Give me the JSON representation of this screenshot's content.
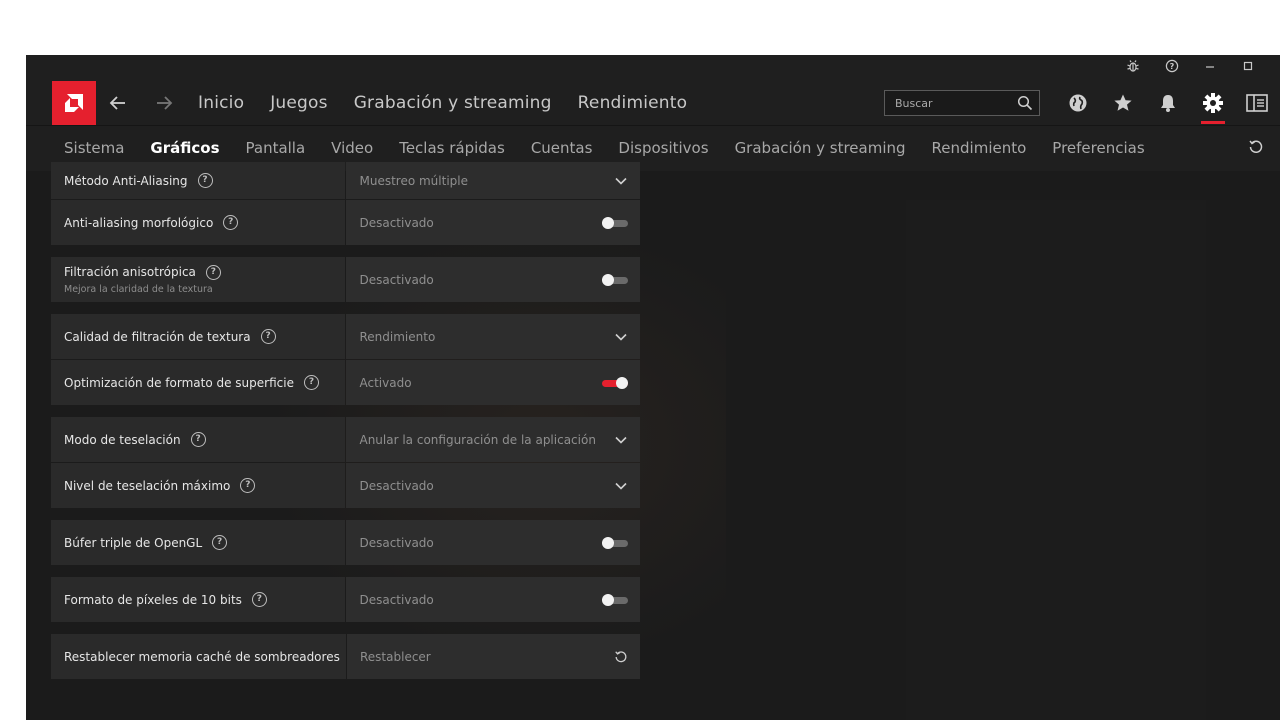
{
  "window": {
    "controls": [
      "bug-icon",
      "help-icon",
      "minimize",
      "maximize"
    ]
  },
  "topnav": {
    "links": [
      "Inicio",
      "Juegos",
      "Grabación y streaming",
      "Rendimiento"
    ],
    "search_placeholder": "Buscar",
    "icons": [
      "globe-icon",
      "star-icon",
      "bell-icon",
      "gear-icon",
      "sidebar-icon"
    ],
    "active_icon": "gear-icon"
  },
  "subnav": {
    "tabs": [
      "Sistema",
      "Gráficos",
      "Pantalla",
      "Video",
      "Teclas rápidas",
      "Cuentas",
      "Dispositivos",
      "Grabación y streaming",
      "Rendimiento",
      "Preferencias"
    ],
    "active": "Gráficos"
  },
  "settings": {
    "aa_method": {
      "label": "Método Anti-Aliasing",
      "value": "Muestreo múltiple",
      "control": "dropdown"
    },
    "morph_aa": {
      "label": "Anti-aliasing morfológico",
      "value": "Desactivado",
      "control": "toggle",
      "on": false
    },
    "aniso": {
      "label": "Filtración anisotrópica",
      "sub": "Mejora la claridad de la textura",
      "value": "Desactivado",
      "control": "toggle",
      "on": false
    },
    "tex_quality": {
      "label": "Calidad de filtración de textura",
      "value": "Rendimiento",
      "control": "dropdown"
    },
    "surface_opt": {
      "label": "Optimización de formato de superficie",
      "value": "Activado",
      "control": "toggle",
      "on": true
    },
    "tess_mode": {
      "label": "Modo de teselación",
      "value": "Anular la configuración de la aplicación",
      "control": "dropdown"
    },
    "tess_max": {
      "label": "Nivel de teselación máximo",
      "value": "Desactivado",
      "control": "dropdown"
    },
    "opengl_tb": {
      "label": "Búfer triple de OpenGL",
      "value": "Desactivado",
      "control": "toggle",
      "on": false
    },
    "tenbit": {
      "label": "Formato de píxeles de 10 bits",
      "value": "Desactivado",
      "control": "toggle",
      "on": false
    },
    "shader_cache": {
      "label": "Restablecer memoria caché de sombreadores",
      "value": "Restablecer",
      "control": "reset"
    }
  },
  "colors": {
    "accent": "#e5202e",
    "background": "#1b1b1b",
    "row_label": "#2a2a2a",
    "row_value": "#2d2d2d"
  }
}
